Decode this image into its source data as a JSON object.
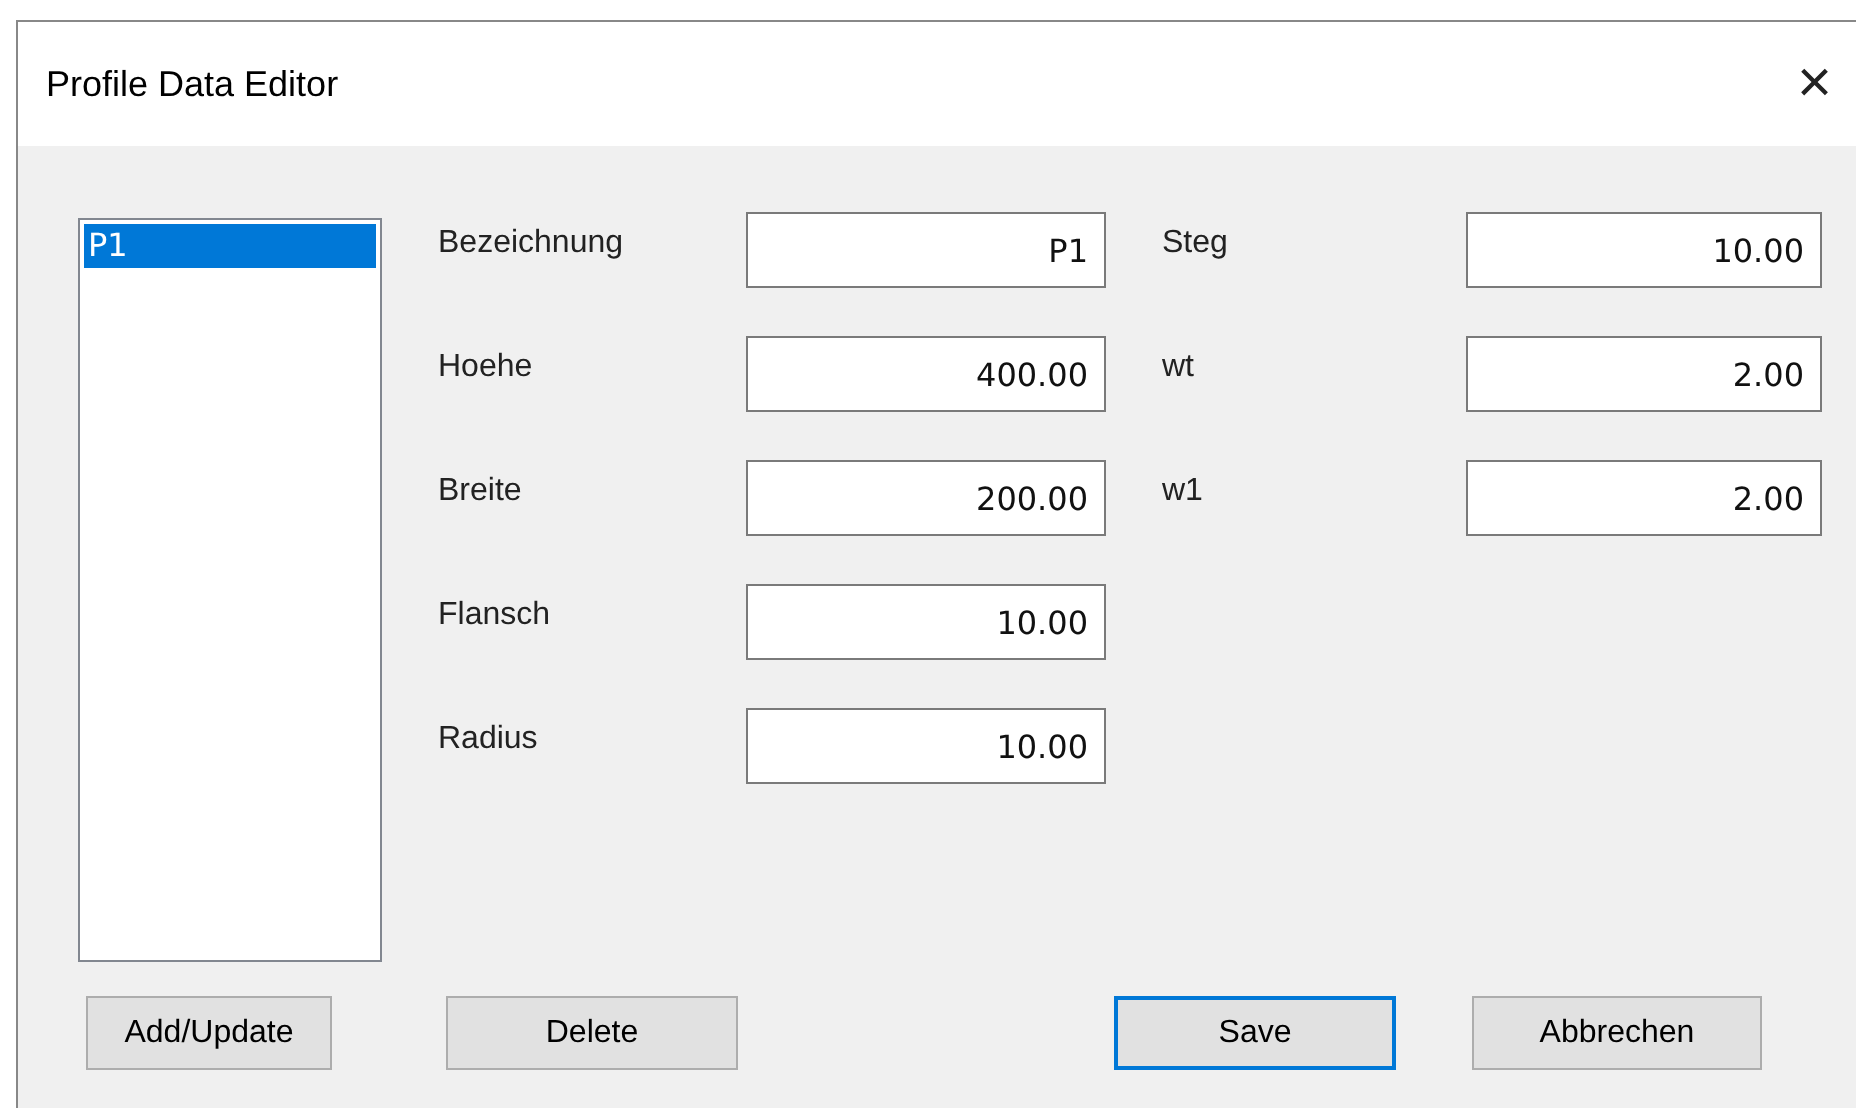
{
  "window": {
    "title": "Profile Data Editor",
    "close": "×"
  },
  "profiles": [
    {
      "name": "P1",
      "selected": true
    }
  ],
  "fields_left": [
    {
      "label": "Bezeichnung",
      "value": "P1"
    },
    {
      "label": "Hoehe",
      "value": "400.00"
    },
    {
      "label": "Breite",
      "value": "200.00"
    },
    {
      "label": "Flansch",
      "value": "10.00"
    },
    {
      "label": "Radius",
      "value": "10.00"
    }
  ],
  "fields_right": [
    {
      "label": "Steg",
      "value": "10.00"
    },
    {
      "label": "wt",
      "value": "2.00"
    },
    {
      "label": "w1",
      "value": "2.00"
    }
  ],
  "buttons": [
    {
      "label": "Add/Update",
      "focused": false
    },
    {
      "label": "Delete",
      "focused": false
    },
    {
      "label": "Save",
      "focused": true
    },
    {
      "label": "Abbrechen",
      "focused": false
    }
  ]
}
